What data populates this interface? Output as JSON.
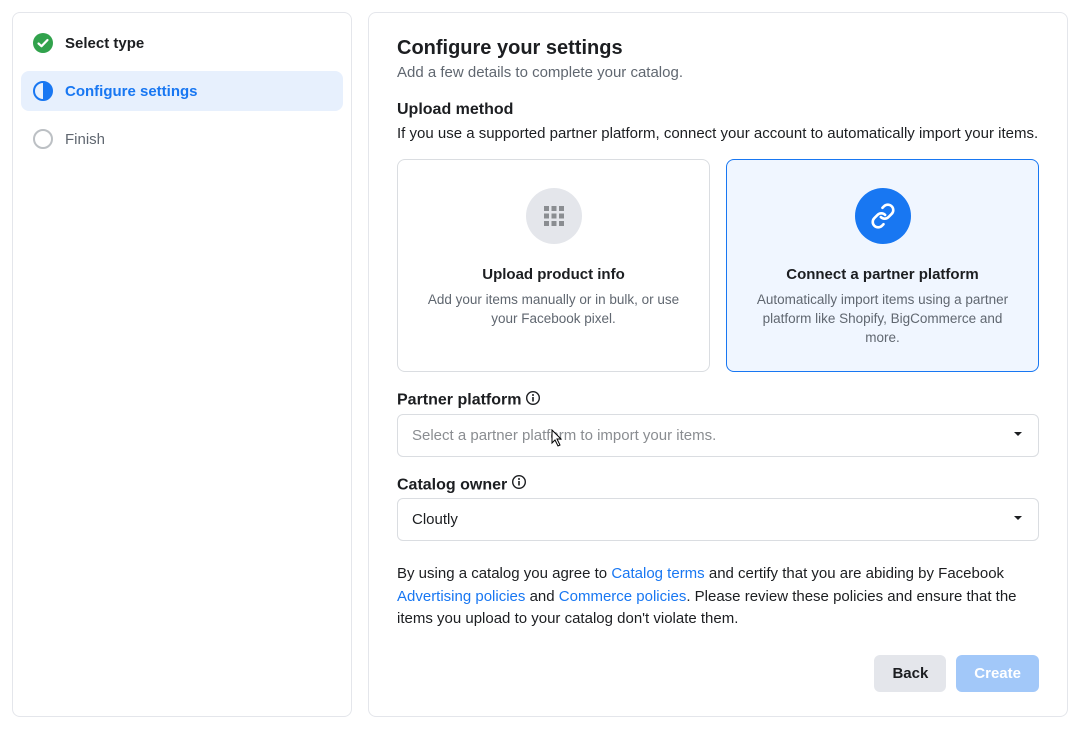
{
  "sidebar": {
    "steps": [
      {
        "label": "Select type",
        "state": "completed"
      },
      {
        "label": "Configure settings",
        "state": "active"
      },
      {
        "label": "Finish",
        "state": "pending"
      }
    ]
  },
  "main": {
    "title": "Configure your settings",
    "subtitle": "Add a few details to complete your catalog.",
    "upload_method": {
      "heading": "Upload method",
      "description": "If you use a supported partner platform, connect your account to automatically import your items.",
      "cards": [
        {
          "title": "Upload product info",
          "desc": "Add your items manually or in bulk, or use your Facebook pixel.",
          "selected": false,
          "icon": "grid"
        },
        {
          "title": "Connect a partner platform",
          "desc": "Automatically import items using a partner platform like Shopify, BigCommerce and more.",
          "selected": true,
          "icon": "link"
        }
      ]
    },
    "partner_platform": {
      "label": "Partner platform",
      "placeholder": "Select a partner platform to import your items."
    },
    "catalog_owner": {
      "label": "Catalog owner",
      "value": "Cloutly"
    },
    "terms": {
      "pre1": "By using a catalog you agree to ",
      "link1": "Catalog terms",
      "mid1": " and certify that you are abiding by Facebook ",
      "link2": "Advertising policies",
      "mid2": " and ",
      "link3": "Commerce policies",
      "post": ". Please review these policies and ensure that the items you upload to your catalog don't violate them."
    },
    "footer": {
      "back": "Back",
      "create": "Create"
    }
  }
}
